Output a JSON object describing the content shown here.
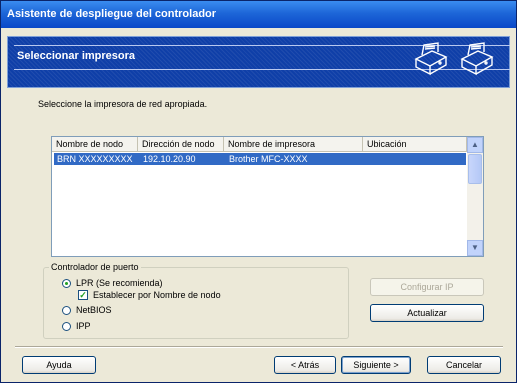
{
  "window": {
    "title": "Asistente de despliegue del controlador"
  },
  "header": {
    "title": "Seleccionar impresora"
  },
  "instruction": "Seleccione la impresora de red apropiada.",
  "printer_list": {
    "columns": [
      "Nombre de nodo",
      "Dirección de nodo",
      "Nombre de impresora",
      "Ubicación"
    ],
    "rows": [
      {
        "node_name": "BRN XXXXXXXXX",
        "node_address": "192.10.20.90",
        "printer_name": "Brother  MFC-XXXX",
        "location": "",
        "selected": true
      }
    ]
  },
  "port_controller": {
    "label": "Controlador de puerto",
    "options": {
      "lpr": "LPR (Se recomienda)",
      "establish_by_node": "Establecer por Nombre de nodo",
      "netbios": "NetBIOS",
      "ipp": "IPP"
    },
    "selected": "lpr",
    "establish_checked": true
  },
  "buttons": {
    "configure_ip": "Configurar IP",
    "update": "Actualizar",
    "help": "Ayuda",
    "back": "< Atrás",
    "next": "Siguiente >",
    "cancel": "Cancelar"
  },
  "colors": {
    "title_bar": "#1D66D8",
    "header_bg": "#0F3FA8",
    "selection": "#316AC5",
    "dialog_bg": "#ECE9D8"
  }
}
